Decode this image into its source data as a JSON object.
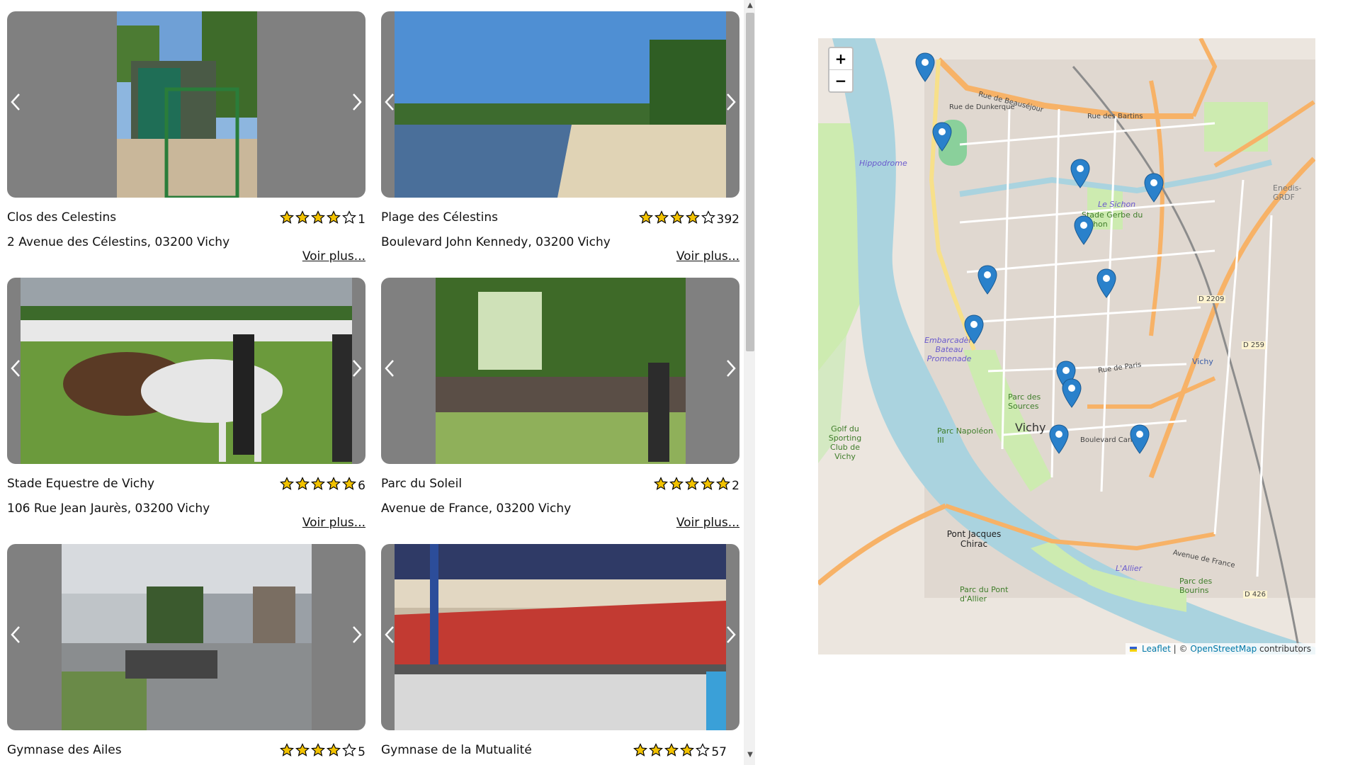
{
  "cards": [
    {
      "name": "Clos des Celestins",
      "stars": 4,
      "count": "1",
      "address": "2 Avenue des Célestins, 03200 Vichy",
      "more": "Voir plus..."
    },
    {
      "name": "Plage des Célestins",
      "stars": 4,
      "count": "392",
      "address": "Boulevard John Kennedy, 03200 Vichy",
      "more": "Voir plus..."
    },
    {
      "name": "Stade Equestre de Vichy",
      "stars": 5,
      "count": "6",
      "address": "106 Rue Jean Jaurès, 03200 Vichy",
      "more": "Voir plus..."
    },
    {
      "name": "Parc du Soleil",
      "stars": 5,
      "count": "2",
      "address": "Avenue de France, 03200 Vichy",
      "more": "Voir plus..."
    },
    {
      "name": "Gymnase des Ailes",
      "stars": 4,
      "count": "5",
      "address": "",
      "more": ""
    },
    {
      "name": "Gymnase de la Mutualité",
      "stars": 4,
      "count": "57",
      "address": "",
      "more": ""
    }
  ],
  "map": {
    "zoom_in": "+",
    "zoom_out": "−",
    "attribution": {
      "leaflet": "Leaflet",
      "separator": " | © ",
      "osm": "OpenStreetMap",
      "suffix": " contributors"
    },
    "labels": {
      "city": "Vichy",
      "hippodrome": "Hippodrome",
      "golf": "Golf du Sporting Club de Vichy",
      "embarcadere": "Embarcadère Bateau Promenade",
      "sichon": "Le Sichon",
      "stade_sichon": "Stade Gerbe du Sichon",
      "pont": "Pont Jacques Chirac",
      "parc_napoleon": "Parc Napoléon III",
      "parc_sources": "Parc des Sources",
      "allier": "L'Allier",
      "parc_pont": "Parc du Pont d'Allier",
      "parc_bourins": "Parc des Bourins",
      "vichy_station": "Vichy",
      "d2209": "D 2209",
      "d259": "D 259",
      "d426": "D 426",
      "rue_beausejour": "Rue de Beauséjour",
      "rue_bartins": "Rue des Bartins",
      "rue_dunkerque": "Rue de Dunkerque",
      "avenue_france": "Avenue de France",
      "boulevard_carnot": "Boulevard Carnot",
      "rue_paris": "Rue de Paris",
      "enedis": "Enedis-GRDF"
    }
  },
  "colors": {
    "marker": "#2a81cb",
    "water": "#aad3df",
    "park": "#cdebb0",
    "road": "#f7b267",
    "scroll_thumb": "#c1c1c1",
    "star_fill": "#f2c200"
  }
}
